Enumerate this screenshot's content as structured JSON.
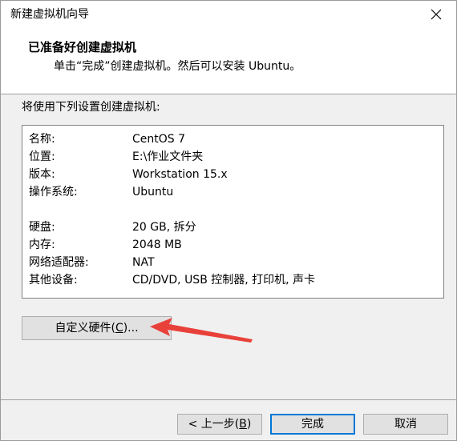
{
  "window": {
    "title": "新建虚拟机向导",
    "close_icon": "close-icon"
  },
  "header": {
    "title": "已准备好创建虚拟机",
    "subtitle": "单击“完成”创建虚拟机。然后可以安装 Ubuntu。"
  },
  "intro": "将使用下列设置创建虚拟机:",
  "summary": [
    {
      "key": "名称:",
      "value": "CentOS 7"
    },
    {
      "key": "位置:",
      "value": "E:\\作业文件夹"
    },
    {
      "key": "版本:",
      "value": "Workstation 15.x"
    },
    {
      "key": "操作系统:",
      "value": "Ubuntu"
    },
    {
      "key": "硬盘:",
      "value": "20 GB, 拆分"
    },
    {
      "key": "内存:",
      "value": "2048 MB"
    },
    {
      "key": "网络适配器:",
      "value": "NAT"
    },
    {
      "key": "其他设备:",
      "value": "CD/DVD, USB 控制器, 打印机, 声卡"
    }
  ],
  "buttons": {
    "customize_pre": "自定义硬件(",
    "customize_key": "C",
    "customize_post": ")...",
    "back_pre": "< 上一步(",
    "back_key": "B",
    "back_post": ")",
    "finish": "完成",
    "cancel": "取消"
  },
  "colors": {
    "accent": "#0078d7",
    "annotation_arrow": "#e8413a"
  }
}
